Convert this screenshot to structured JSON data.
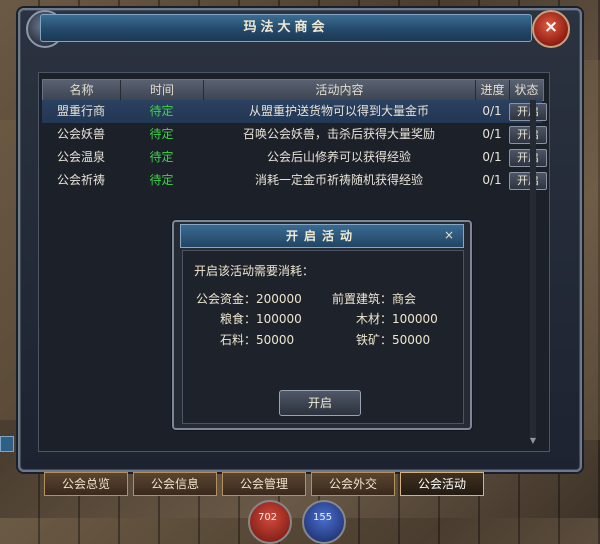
{
  "window": {
    "title": "玛法大商会",
    "help_icon": "question-mark-icon",
    "close_icon": "close-icon"
  },
  "table": {
    "headers": [
      "名称",
      "时间",
      "活动内容",
      "进度",
      "状态"
    ],
    "rows": [
      {
        "name": "盟重行商",
        "time": "待定",
        "desc": "从盟重护送货物可以得到大量金币",
        "progress": "0/1",
        "action": "开启"
      },
      {
        "name": "公会妖兽",
        "time": "待定",
        "desc": "召唤公会妖兽，击杀后获得大量奖励",
        "progress": "0/1",
        "action": "开启"
      },
      {
        "name": "公会温泉",
        "time": "待定",
        "desc": "公会后山修养可以获得经验",
        "progress": "0/1",
        "action": "开启"
      },
      {
        "name": "公会祈祷",
        "time": "待定",
        "desc": "消耗一定金币祈祷随机获得经验",
        "progress": "0/1",
        "action": "开启"
      }
    ]
  },
  "dialog": {
    "title": "开启活动",
    "close": "×",
    "prompt": "开启该活动需要消耗：",
    "costs": {
      "fund": "公会资金：200000",
      "building": "前置建筑：商会",
      "food": "粮食：100000",
      "wood": "木材：100000",
      "stone": "石料：50000",
      "iron": "铁矿：50000"
    },
    "confirm": "开启"
  },
  "tabs": [
    "公会总览",
    "公会信息",
    "公会管理",
    "公会外交",
    "公会活动"
  ],
  "active_tab": "公会活动",
  "orbs": {
    "hp": "702",
    "mp": "155"
  },
  "colors": {
    "time_green": "#3fd24a",
    "title_blue": "#2b587c",
    "close_red": "#c0392b"
  }
}
